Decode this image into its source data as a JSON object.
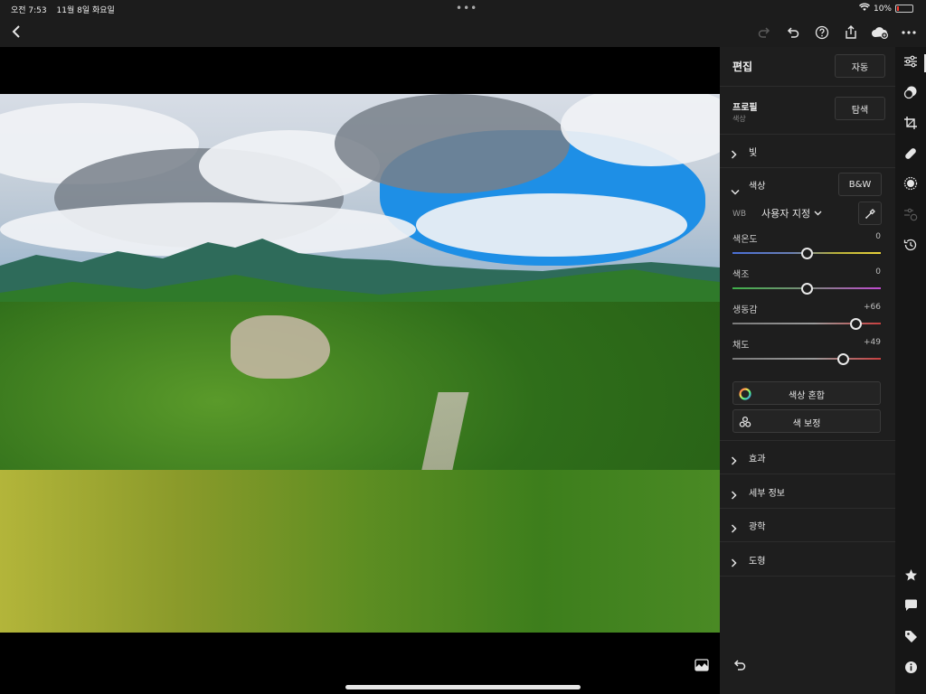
{
  "status_bar": {
    "time": "오전 7:53",
    "date": "11월 8일 화요일",
    "battery_percent": "10%",
    "battery_level": 0.1
  },
  "panel": {
    "title": "편집",
    "auto_label": "자동",
    "profile": {
      "title": "프로필",
      "subtitle": "색상",
      "browse_label": "탐색"
    },
    "sections_top": [
      {
        "label": "빛"
      }
    ],
    "color": {
      "title": "색상",
      "bw_label": "B&W",
      "wb_label": "WB",
      "wb_value": "사용자 지정",
      "sliders": [
        {
          "label": "색온도",
          "value": "0",
          "position": 0.5,
          "track": "temp"
        },
        {
          "label": "색조",
          "value": "0",
          "position": 0.5,
          "track": "tint"
        },
        {
          "label": "생동감",
          "value": "+66",
          "position": 0.83,
          "track": "neutral"
        },
        {
          "label": "채도",
          "value": "+49",
          "position": 0.745,
          "track": "neutral"
        }
      ],
      "color_mix_label": "색상 혼합",
      "color_grading_label": "색 보정"
    },
    "sections_bottom": [
      {
        "label": "효과"
      },
      {
        "label": "세부 정보"
      },
      {
        "label": "광학"
      },
      {
        "label": "도형"
      }
    ]
  },
  "colors": {
    "accent": "#e6e6e6",
    "battery_low": "#ff3b30",
    "panel_bg": "#1e1e1e"
  }
}
